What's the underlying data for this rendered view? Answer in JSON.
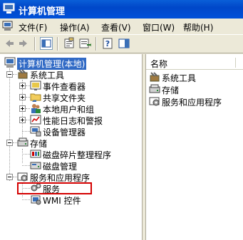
{
  "window": {
    "title": "计算机管理"
  },
  "menu": [
    "文件(F)",
    "操作(A)",
    "查看(V)",
    "窗口(W)",
    "帮助(H)"
  ],
  "toolbar": {
    "icons": [
      "back-icon",
      "forward-icon",
      "show-hide-tree-icon",
      "properties-icon",
      "help-icon",
      "show-hide-action-pane-icon"
    ]
  },
  "tree": {
    "root": "计算机管理(本地)",
    "system_tools": "系统工具",
    "event_viewer": "事件查看器",
    "shared_folders": "共享文件夹",
    "local_users": "本地用户和组",
    "perf_logs": "性能日志和警报",
    "device_manager": "设备管理器",
    "storage": "存储",
    "defrag": "磁盘碎片整理程序",
    "disk_mgmt": "磁盘管理",
    "services_apps": "服务和应用程序",
    "services": "服务",
    "wmi": "WMI 控件"
  },
  "list": {
    "column_header": "名称",
    "items": [
      "系统工具",
      "存储",
      "服务和应用程序"
    ]
  },
  "colors": {
    "title_bar": "#0050d8",
    "selection": "#316ac5",
    "highlight_box": "#d40000"
  }
}
